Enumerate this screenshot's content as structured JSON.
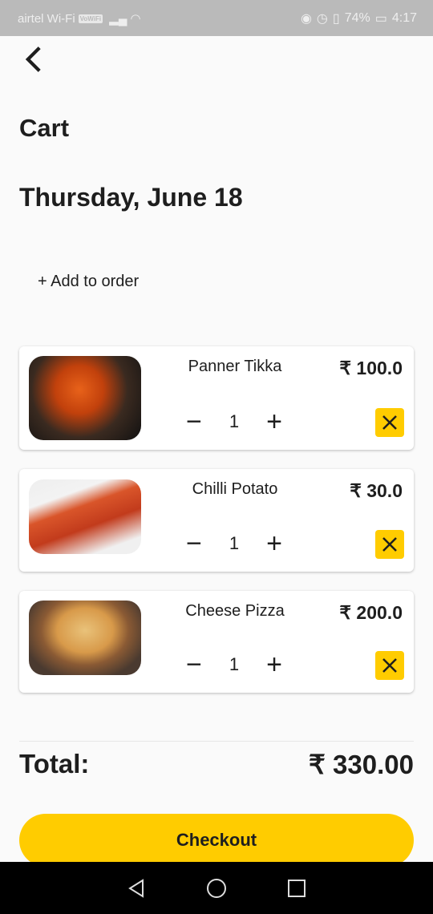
{
  "status_bar": {
    "carrier": "airtel Wi-Fi",
    "wifi_badge": "VoWiFi",
    "battery": "74%",
    "time": "4:17"
  },
  "header": {
    "title": "Cart",
    "date": "Thursday, June 18"
  },
  "add_to_order": "+ Add to order",
  "items": [
    {
      "name": "Panner Tikka",
      "price": "₹ 100.0",
      "qty": "1"
    },
    {
      "name": "Chilli Potato",
      "price": "₹ 30.0",
      "qty": "1"
    },
    {
      "name": "Cheese Pizza",
      "price": "₹ 200.0",
      "qty": "1"
    }
  ],
  "total": {
    "label": "Total:",
    "value": "₹ 330.00"
  },
  "checkout_label": "Checkout",
  "colors": {
    "accent": "#ffcc00"
  }
}
